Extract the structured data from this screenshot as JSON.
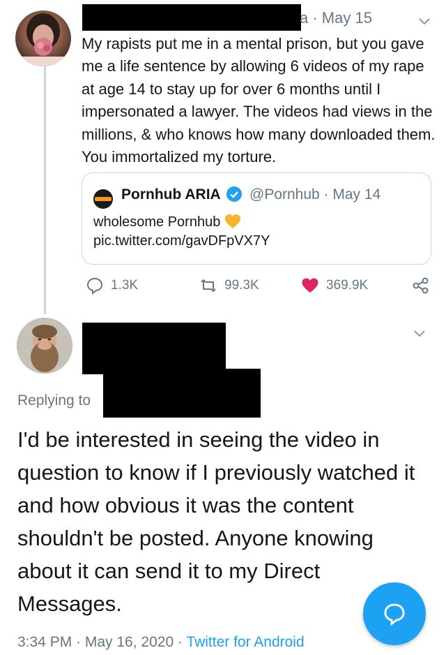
{
  "tweet1": {
    "avatar_icon": "profile-photo-woman",
    "date": "a · May 15",
    "text": "My rapists put me in a mental prison, but you gave me a life sentence by allowing 6 videos of my rape at age 14 to stay up for over 6 months until I impersonated a lawyer. The videos had views in the millions, & who knows how many downloaded them. You immortalized my torture.",
    "quote": {
      "name": "Pornhub ARIA",
      "handle_date": "@Pornhub · May 14",
      "text_line1": "wholesome Pornhub",
      "text_line2": "pic.twitter.com/gavDFpVX7Y",
      "emoji": "orange-heart-icon"
    },
    "actions": {
      "replies": "1.3K",
      "retweets": "99.3K",
      "likes": "369.9K"
    },
    "colors": {
      "like": "#e0245e",
      "accent": "#1da1f2"
    }
  },
  "tweet2": {
    "avatar_icon": "profile-photo-bearded-man",
    "replying_to": "Replying to",
    "text": "I'd be interested in seeing the video in question to know if I previously watched it and how obvious it was the content shouldn't be posted. Anyone knowing about it can send it to my Direct Messages.",
    "footer_time": "3:34 PM · May 16, 2020 · ",
    "footer_source": "Twitter for Android"
  },
  "compose_button": {
    "icon": "reply-compose-icon"
  }
}
